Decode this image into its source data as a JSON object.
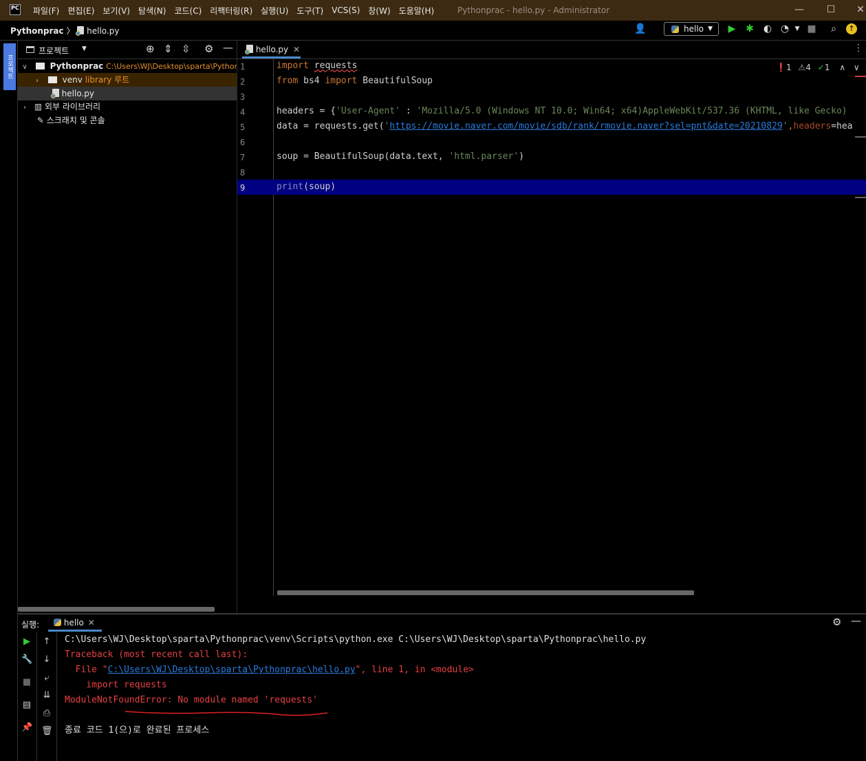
{
  "window": {
    "title": "Pythonprac - hello.py - Administrator",
    "logo": "PC",
    "menu": [
      "파일(F)",
      "편집(E)",
      "보기(V)",
      "탐색(N)",
      "코드(C)",
      "리팩터링(R)",
      "실행(U)",
      "도구(T)",
      "VCS(S)",
      "창(W)",
      "도움말(H)"
    ],
    "controls": {
      "minimize": "—",
      "maximize": "☐",
      "close": "✕"
    }
  },
  "navbar": {
    "project": "Pythonprac",
    "separator": "〉",
    "file": "hello.py",
    "run_config": "hello",
    "icons": [
      "user-icon",
      "run-icon",
      "debug-icon",
      "coverage-icon",
      "profile-icon",
      "stop-icon",
      "search-icon",
      "update-icon"
    ]
  },
  "sidebar": {
    "project_tab": "프로젝트"
  },
  "project_panel": {
    "title": "프로젝트",
    "tree": [
      {
        "label": "Pythonprac",
        "path": "C:\\Users\\WJ\\Desktop\\sparta\\Pythonprac"
      },
      {
        "label": "venv",
        "note": "library 루트"
      },
      {
        "label": "hello.py"
      },
      {
        "label": "외부 라이브러리"
      },
      {
        "label": "스크래치 및 콘솔"
      }
    ]
  },
  "editor": {
    "tab": "hello.py",
    "inspections": {
      "errors": "1",
      "warnings": "4",
      "typos": "1"
    },
    "line_numbers": [
      "1",
      "2",
      "3",
      "4",
      "5",
      "6",
      "7",
      "8",
      "9"
    ],
    "code": {
      "l1_kw": "import",
      "l1_mod": "requests",
      "l2_kw1": "from",
      "l2_mod": " bs4 ",
      "l2_kw2": "import",
      "l2_name": " BeautifulSoup",
      "l4_a": "headers = {",
      "l4_s1": "'User-Agent'",
      "l4_b": " : ",
      "l4_s2": "'Mozilla/5.0 (Windows NT 10.0; Win64; x64)AppleWebKit/537.36 (KHTML, like Gecko)",
      "l5_a": "data = requests.get(",
      "l5_q1": "'",
      "l5_url": "https://movie.naver.com/movie/sdb/rank/rmovie.naver?sel=pnt&date=20210829",
      "l5_q2": "'",
      "l5_b": ",",
      "l5_param": "headers",
      "l5_c": "=hea",
      "l7_a": "soup = BeautifulSoup(data.text, ",
      "l7_s": "'html.parser'",
      "l7_b": ")",
      "l9_fn": "print",
      "l9_a": "(soup)"
    }
  },
  "run_panel": {
    "label": "실행:",
    "tab": "hello",
    "console": [
      "C:\\Users\\WJ\\Desktop\\sparta\\Pythonprac\\venv\\Scripts\\python.exe C:\\Users\\WJ\\Desktop\\sparta\\Pythonprac\\hello.py",
      "Traceback (most recent call last):",
      "  File \"",
      "C:\\Users\\WJ\\Desktop\\sparta\\Pythonprac\\hello.py",
      "\", line 1, in <module>",
      "    import requests",
      "ModuleNotFoundError: No module named 'requests'",
      "종료 코드 1(으)로 완료된 프로세스"
    ]
  },
  "colors": {
    "titlebar": "#3c2a12",
    "selection": "#4a7ae0",
    "current_line": "#000080",
    "error_text": "#e84040",
    "keyword": "#cc7832",
    "string": "#6a8759",
    "link": "#287bde",
    "venv_note": "#e8902c",
    "path_note": "#e8902c"
  }
}
